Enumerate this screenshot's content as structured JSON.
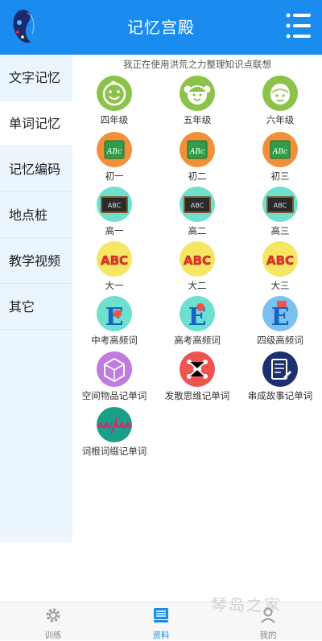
{
  "header": {
    "title": "记忆宫殿",
    "menu_icon": "list-menu-icon",
    "logo_icon": "butterfly-logo-icon"
  },
  "sidebar": {
    "items": [
      {
        "label": "文字记忆",
        "active": false
      },
      {
        "label": "单词记忆",
        "active": true
      },
      {
        "label": "记忆编码",
        "active": false
      },
      {
        "label": "地点桩",
        "active": false
      },
      {
        "label": "教学视频",
        "active": false
      },
      {
        "label": "其它",
        "active": false
      }
    ]
  },
  "notice": "我正在使用洪荒之力整理知识点联想",
  "grid": {
    "items": [
      {
        "label": "四年级",
        "icon": "smiley-face-icon",
        "color": "#8bc34a"
      },
      {
        "label": "五年级",
        "icon": "girl-face-icon",
        "color": "#8bc34a"
      },
      {
        "label": "六年级",
        "icon": "boy-face-icon",
        "color": "#8bc34a"
      },
      {
        "label": "初一",
        "icon": "green-board-abc-icon",
        "color": "#f0913a"
      },
      {
        "label": "初二",
        "icon": "green-board-abc-icon",
        "color": "#f0913a"
      },
      {
        "label": "初三",
        "icon": "green-board-abc-icon",
        "color": "#f0913a"
      },
      {
        "label": "高一",
        "icon": "blackboard-abc-icon",
        "color": "#6ee0cf"
      },
      {
        "label": "高二",
        "icon": "blackboard-abc-icon",
        "color": "#6ee0cf"
      },
      {
        "label": "高三",
        "icon": "blackboard-abc-icon",
        "color": "#6ee0cf"
      },
      {
        "label": "大一",
        "icon": "abc-letters-icon",
        "color": "#f5e663"
      },
      {
        "label": "大二",
        "icon": "abc-letters-icon",
        "color": "#f5e663"
      },
      {
        "label": "大三",
        "icon": "abc-letters-icon",
        "color": "#f5e663"
      },
      {
        "label": "中考高频词",
        "icon": "letter-e-icon",
        "color": "#6ee0cf"
      },
      {
        "label": "高考高频词",
        "icon": "letter-e-icon",
        "color": "#6ee0cf"
      },
      {
        "label": "四级高频词",
        "icon": "letter-e-icon",
        "color": "#7cc0f0"
      },
      {
        "label": "空间物品记单词",
        "icon": "cube-icon",
        "color": "#c07ae0"
      },
      {
        "label": "发散思维记单词",
        "icon": "network-icon",
        "color": "#ef5350"
      },
      {
        "label": "串成故事记单词",
        "icon": "document-edit-icon",
        "color": "#1c2f6e"
      },
      {
        "label": "词根词缀记单词",
        "icon": "aa-letters-icon",
        "color": "#1aa08a"
      }
    ]
  },
  "bottom_nav": {
    "tabs": [
      {
        "label": "训练",
        "icon": "gear-icon"
      },
      {
        "label": "资料",
        "icon": "book-stack-icon"
      },
      {
        "label": "我的",
        "icon": "person-icon"
      }
    ]
  },
  "watermark": "琴岛之家"
}
